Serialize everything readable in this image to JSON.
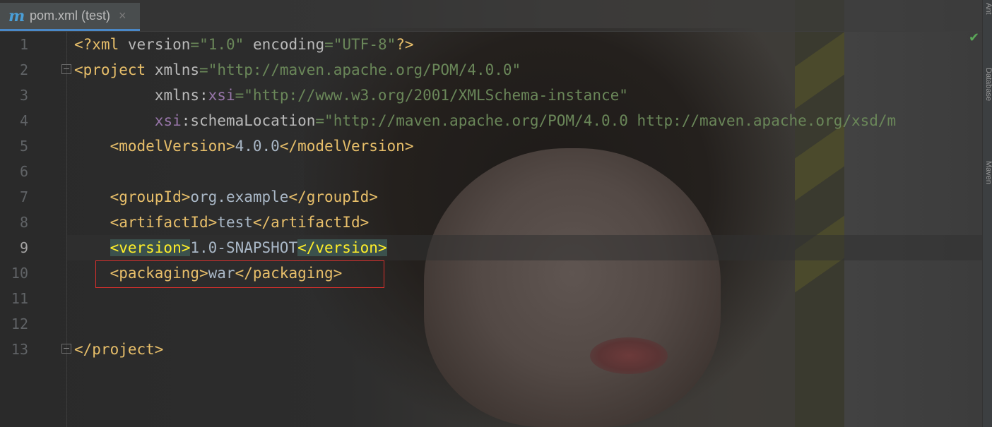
{
  "tab": {
    "icon": "maven-m-icon",
    "label": "pom.xml (test)",
    "close": "×"
  },
  "line_numbers": [
    "1",
    "2",
    "3",
    "4",
    "5",
    "6",
    "7",
    "8",
    "9",
    "10",
    "11",
    "12",
    "13"
  ],
  "active_line": 9,
  "code": {
    "l1": {
      "p1": "<?",
      "tag": "xml",
      "sp1": " ",
      "a1": "version",
      "eq1": "=",
      "s1": "\"1.0\"",
      "sp2": " ",
      "a2": "encoding",
      "eq2": "=",
      "s2": "\"UTF-8\"",
      "end": "?>"
    },
    "l2": {
      "open": "<project",
      "sp": " ",
      "attr": "xmlns",
      "eq": "=",
      "val": "\"http://maven.apache.org/POM/4.0.0\""
    },
    "l3": {
      "indent": "         ",
      "attr": "xmlns:",
      "ns": "xsi",
      "eq": "=",
      "val": "\"http://www.w3.org/2001/XMLSchema-instance\""
    },
    "l4": {
      "indent": "         ",
      "ns": "xsi",
      "attr": ":schemaLocation",
      "eq": "=",
      "val": "\"http://maven.apache.org/POM/4.0.0 http://maven.apache.org/xsd/m"
    },
    "l5": {
      "indent": "    ",
      "open": "<modelVersion>",
      "text": "4.0.0",
      "close": "</modelVersion>"
    },
    "l7": {
      "indent": "    ",
      "open": "<groupId>",
      "text": "org.example",
      "close": "</groupId>"
    },
    "l8": {
      "indent": "    ",
      "open": "<artifactId>",
      "text": "test",
      "close": "</artifactId>"
    },
    "l9": {
      "indent": "    ",
      "open": "<version>",
      "text": "1.0-SNAPSHOT",
      "close": "</version>"
    },
    "l10": {
      "indent": "    ",
      "open": "<packaging>",
      "text": "war",
      "close": "</packaging>"
    },
    "l13": {
      "close": "</project>"
    }
  },
  "right_tools": [
    "Ant",
    "Database",
    "Maven"
  ],
  "status_icon": "check-icon",
  "status_mark": "✔",
  "colors": {
    "tag": "#e8bf6a",
    "string": "#6a8759",
    "namespace": "#9876aa",
    "text": "#a9b7c6",
    "line_number": "#606366",
    "highlight_box": "#d9302c"
  }
}
